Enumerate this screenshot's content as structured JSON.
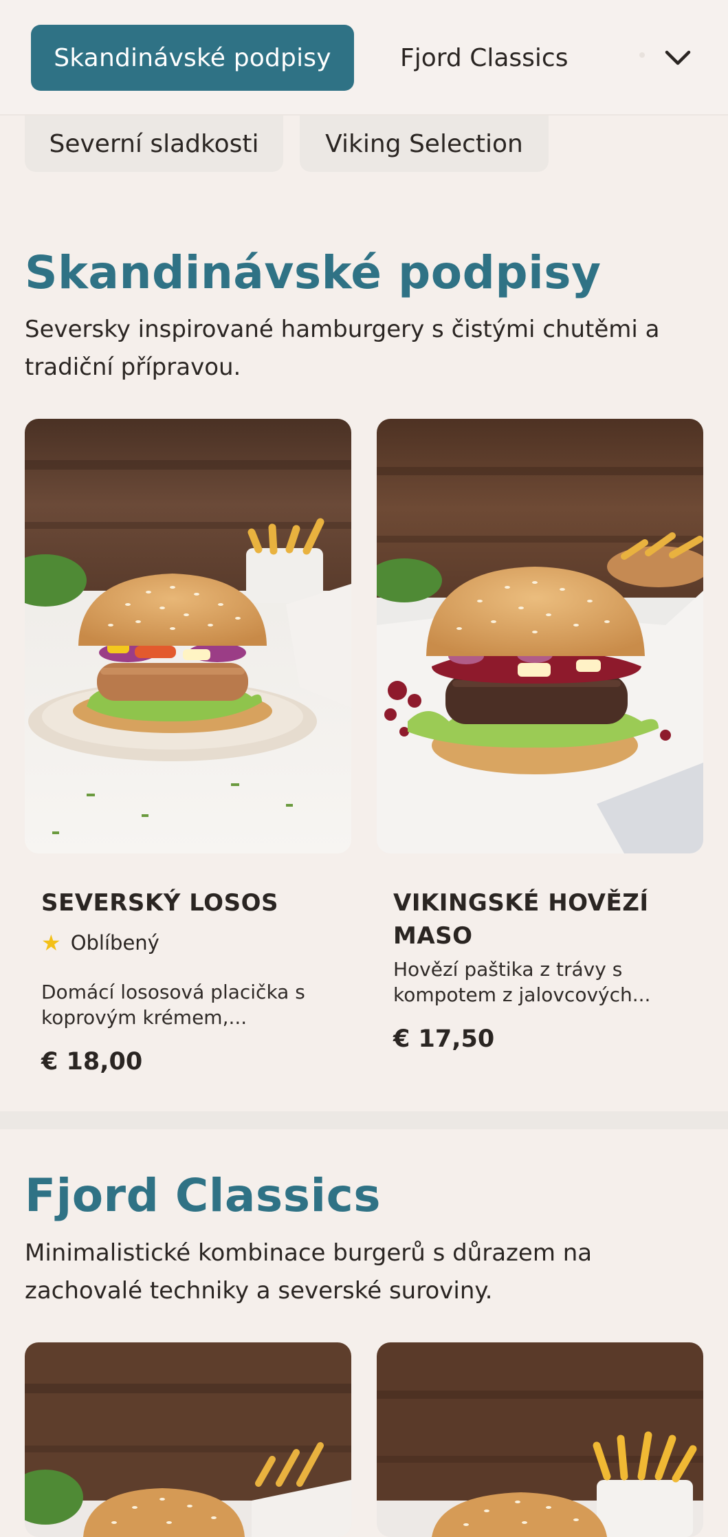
{
  "nav": {
    "active_category": "Skandinávské podpisy",
    "second_category": "Fjord Classics",
    "row2": [
      "Severní sladkosti",
      "Viking Selection"
    ],
    "more_icon": "chevron-down-icon"
  },
  "colors": {
    "accent": "#2f7285",
    "background": "#f5efeb",
    "star": "#f3c017"
  },
  "sections": [
    {
      "title": "Skandinávské podpisy",
      "description": "Seversky inspirované hamburgery s čistými chutěmi a tradiční přípravou.",
      "products": [
        {
          "name": "SEVERSKÝ LOSOS",
          "badge": "Oblíbený",
          "badge_icon": "star-icon",
          "description": "Domácí lososová placička s koprovým krémem,...",
          "price": "€ 18,00"
        },
        {
          "name": "VIKINGSKÉ HOVĚZÍ MASO",
          "description": "Hovězí paštika z trávy s kompotem z jalovcových...",
          "price": "€ 17,50"
        }
      ]
    },
    {
      "title": "Fjord Classics",
      "description": "Minimalistické kombinace burgerů s důrazem na zachovalé techniky a severské suroviny."
    }
  ]
}
